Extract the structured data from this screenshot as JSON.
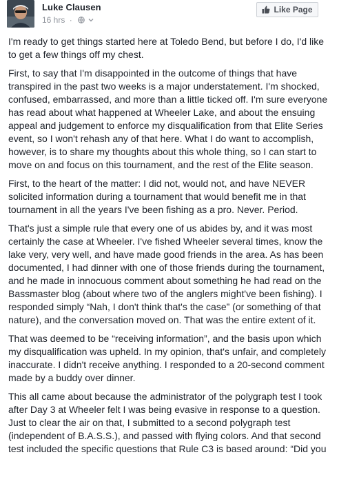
{
  "post": {
    "author": "Luke Clausen",
    "time": "16 hrs",
    "like_button": "Like Page",
    "paragraphs": [
      "I'm ready to get things started here at Toledo Bend, but before I do, I'd like to get a few things off my chest.",
      "First, to say that I'm disappointed in the outcome of things that have transpired in the past two weeks is a major understatement. I'm shocked, confused, embarrassed, and more than a little ticked off. I'm sure everyone has read about what happened at Wheeler Lake, and about the ensuing appeal and judgement to enforce my disqualification from that Elite Series event, so I won't rehash any of that here. What I do want to accomplish, however, is to share my thoughts about this whole thing, so I can start to move on and focus on this tournament, and the rest of the Elite season.",
      "First, to the heart of the matter: I did not, would not, and have NEVER solicited information during a tournament that would benefit me in that tournament in all the years I've been fishing as a pro. Never. Period.",
      "That's just a simple rule that every one of us abides by, and it was most certainly the case at Wheeler. I've fished Wheeler several times, know the lake very, very well, and have made good friends in the area. As has been documented, I had dinner with one of those friends during the tournament, and he made in innocuous comment about something he had read on the Bassmaster blog (about where two of the anglers might've been fishing). I responded simply “Nah, I don't think that's the case” (or something of that nature), and the conversation moved on. That was the entire extent of it.",
      "That was deemed to be “receiving information”, and the basis upon which my disqualification was upheld. In my opinion, that's unfair, and completely inaccurate. I didn't receive anything. I responded to a 20-second comment made by a buddy over dinner.",
      "This all came about because the administrator of the polygraph test I took after Day 3 at Wheeler felt I was being evasive in response to a question. Just to clear the air on that, I submitted to a second polygraph test (independent of B.A.S.S.), and passed with flying colors. And that second test included the specific questions that Rule C3 is based around: “Did you"
    ]
  },
  "colors": {
    "text": "#1d2129",
    "meta": "#90949c",
    "button_bg": "#f6f7f9",
    "button_border": "#ccd0d5"
  },
  "icons": [
    "avatar-photo",
    "globe-icon",
    "chevron-down-icon",
    "thumbs-up-icon"
  ]
}
